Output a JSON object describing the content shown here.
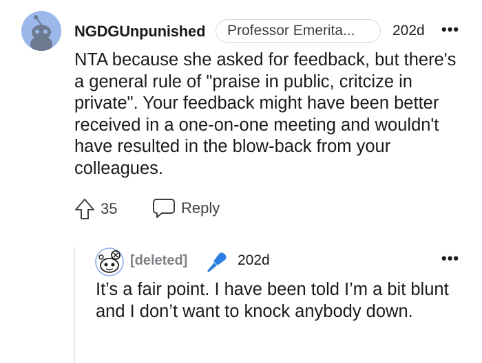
{
  "comment": {
    "username": "NGDGUnpunished",
    "flair": "Professor Emerita...",
    "time": "202d",
    "more": "•••",
    "body": "NTA because she asked for feedback, but there's a general rule of \"praise in public, critcize in private\". Your feedback might have been better received in a one-on-one meeting and wouldn't have resulted in the blow-back from your colleagues.",
    "upvotes": "35",
    "reply_label": "Reply",
    "icons": {
      "avatar": "reddit-avatar-icon",
      "upvote": "upvote-arrow-icon",
      "reply": "speech-bubble-icon"
    }
  },
  "reply": {
    "username": "[deleted]",
    "time": "202d",
    "more": "•••",
    "body": "It’s a fair point. I have been told I’m a bit blunt and I don’t want to knock anybody down.",
    "icons": {
      "avatar": "snoo-avatar-icon",
      "badge": "microphone-icon"
    }
  },
  "colors": {
    "avatar_bg": "#9cb8ea",
    "mic_blue": "#2a7fe0",
    "text": "#1a1a1b",
    "muted": "#7c7f83"
  }
}
